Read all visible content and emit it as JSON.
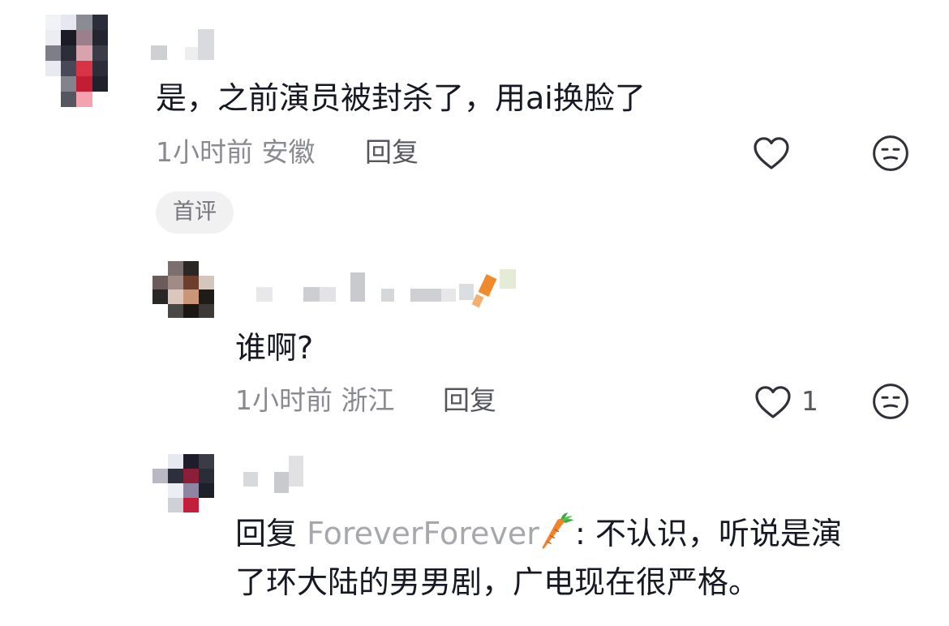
{
  "comments": [
    {
      "content": "是，之前演员被封杀了，用ai换脸了",
      "time": "1小时前",
      "location": "安徽",
      "reply_label": "回复",
      "badge": "首评",
      "likes": ""
    },
    {
      "content": "谁啊?",
      "time": "1小时前",
      "location": "浙江",
      "reply_label": "回复",
      "likes": "1"
    },
    {
      "reply_prefix": "回复",
      "mention": "ForeverForever",
      "mention_icon": "carrot-emoji",
      "colon": ":",
      "line1": "不认识，听说是演",
      "line2": "了环大陆的男男剧，广电现在很严格。"
    }
  ],
  "colors": {
    "text": "#161823",
    "meta": "#8a8b91",
    "reply": "#56575e",
    "mention": "#a7a8ad",
    "badge_bg": "#f1f1f2"
  }
}
